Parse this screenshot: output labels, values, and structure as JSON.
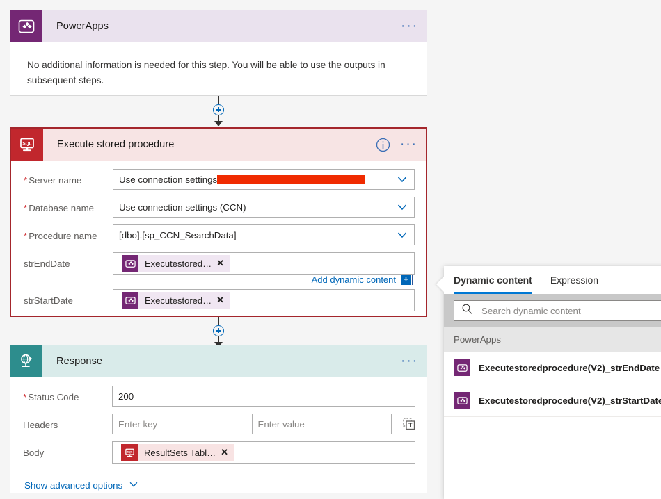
{
  "powerapps_card": {
    "title": "PowerApps",
    "icon": "powerapps-icon",
    "body_text": "No additional information is needed for this step. You will be able to use the outputs in subsequent steps.",
    "more_label": "···",
    "header_bg": "#eae2ee",
    "icon_bg": "#742774"
  },
  "sql_card": {
    "title": "Execute stored procedure",
    "icon": "sql-server-icon",
    "more_label": "···",
    "info_label": "i",
    "header_bg": "#f7e4e4",
    "icon_bg": "#c1272d",
    "border_color": "#a4262c",
    "fields": [
      {
        "label": "Server name",
        "required": true,
        "value": "Use connection settings",
        "redacted": true,
        "has_chevron": true
      },
      {
        "label": "Database name",
        "required": true,
        "value": "Use connection settings (CCN)",
        "redacted": false,
        "has_chevron": true
      },
      {
        "label": "Procedure name",
        "required": true,
        "value": "[dbo].[sp_CCN_SearchData]",
        "redacted": false,
        "has_chevron": true
      }
    ],
    "parameters": [
      {
        "label": "strEndDate",
        "chip_label": "Executestored…",
        "chip_close": "✕"
      },
      {
        "label": "strStartDate",
        "chip_label": "Executestored…",
        "chip_close": "✕"
      }
    ],
    "add_dynamic_content": "Add dynamic content",
    "add_dynamic_plus": "+"
  },
  "response_card": {
    "title": "Response",
    "icon": "response-globe-icon",
    "more_label": "···",
    "header_bg": "#d9ebea",
    "icon_bg": "#2d8d8d",
    "status_code": {
      "label": "Status Code",
      "required": true,
      "value": "200"
    },
    "headers": {
      "label": "Headers",
      "key_placeholder": "Enter key",
      "value_placeholder": "Enter value",
      "switch_icon": "switch-to-text-input-icon"
    },
    "body": {
      "label": "Body",
      "chip_label": "ResultSets Tabl…",
      "chip_close": "✕"
    },
    "advanced_options": "Show advanced options"
  },
  "dynamic_panel": {
    "tabs": [
      {
        "label": "Dynamic content",
        "active": true
      },
      {
        "label": "Expression",
        "active": false
      }
    ],
    "search_placeholder": "Search dynamic content",
    "search_value": "",
    "search_icon": "search-icon",
    "group_label": "PowerApps",
    "items": [
      {
        "label": "Executestoredprocedure(V2)_strEndDate",
        "icon": "powerapps-icon"
      },
      {
        "label": "Executestoredprocedure(V2)_strStartDate",
        "icon": "powerapps-icon"
      }
    ]
  },
  "connectors": [
    {
      "plus_label": "+"
    },
    {
      "plus_label": "+"
    }
  ],
  "colors": {
    "page_bg": "#f5f5f5",
    "accent_blue": "#0067b8",
    "tab_underline": "#0078d4",
    "required_star": "#d13438",
    "redaction": "#f02b00"
  }
}
